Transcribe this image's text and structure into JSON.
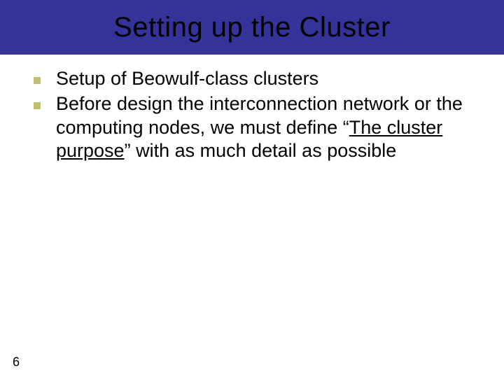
{
  "slide": {
    "title": "Setting up the Cluster",
    "pageNumber": "6",
    "bullets": [
      {
        "text_before": "Setup of Beowulf-class clusters",
        "underlined": "",
        "text_after": ""
      },
      {
        "text_before": "Before design the interconnection network or the computing nodes, we must define “",
        "underlined": "The cluster purpose",
        "text_after": "” with as much detail as possible"
      }
    ]
  }
}
